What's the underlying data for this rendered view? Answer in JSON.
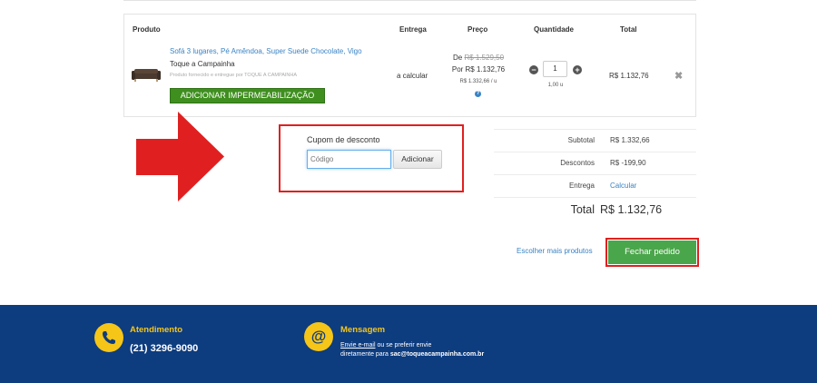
{
  "cart": {
    "headers": {
      "product": "Produto",
      "delivery": "Entrega",
      "price": "Preço",
      "quantity": "Quantidade",
      "total": "Total"
    },
    "item": {
      "name": "Sofá 3 lugares, Pé Amêndoa, Super Suede Chocolate, Vigo",
      "seller": "Toque a Campainha",
      "note": "Produto fornecido e entregue por TOQUE A CAMPAINHA",
      "waterproof_label": "ADICIONAR IMPERMEABILIZAÇÃO",
      "delivery": "a calcular",
      "price_de_prefix": "De",
      "price_de": "R$ 1.529,50",
      "price_por": "Por R$ 1.132,76",
      "price_unit": "R$ 1.332,66 / u",
      "quantity": "1",
      "quantity_unit": "1,00 u",
      "total": "R$ 1.132,76",
      "remove_glyph": "✖"
    }
  },
  "coupon": {
    "label": "Cupom de desconto",
    "placeholder": "Código",
    "button": "Adicionar"
  },
  "summary": {
    "subtotal_label": "Subtotal",
    "subtotal_value": "R$ 1.332,66",
    "discount_label": "Descontos",
    "discount_value": "R$ -199,90",
    "delivery_label": "Entrega",
    "delivery_value": "Calcular",
    "total_label": "Total",
    "total_value": "R$ 1.132,76"
  },
  "actions": {
    "more_products": "Escolher mais produtos",
    "checkout": "Fechar pedido"
  },
  "footer": {
    "service_title": "Atendimento",
    "service_phone": "(21) 3296-9090",
    "message_title": "Mensagem",
    "message_link": "Envie e-mail",
    "message_text1": " ou se preferir envie",
    "message_text2": "diretamente para ",
    "message_email": "sac@toqueacampainha.com.br"
  },
  "colors": {
    "link": "#3a83c5",
    "green_button": "#3f8f1f",
    "checkout": "#4aa64a",
    "highlight_red": "#e02020",
    "footer_bg": "#0d3c7f",
    "footer_accent": "#f5c518"
  },
  "icons": {
    "arrow": "red-right-arrow-icon",
    "info": "info-icon",
    "phone": "phone-icon",
    "at": "at-sign-icon"
  }
}
